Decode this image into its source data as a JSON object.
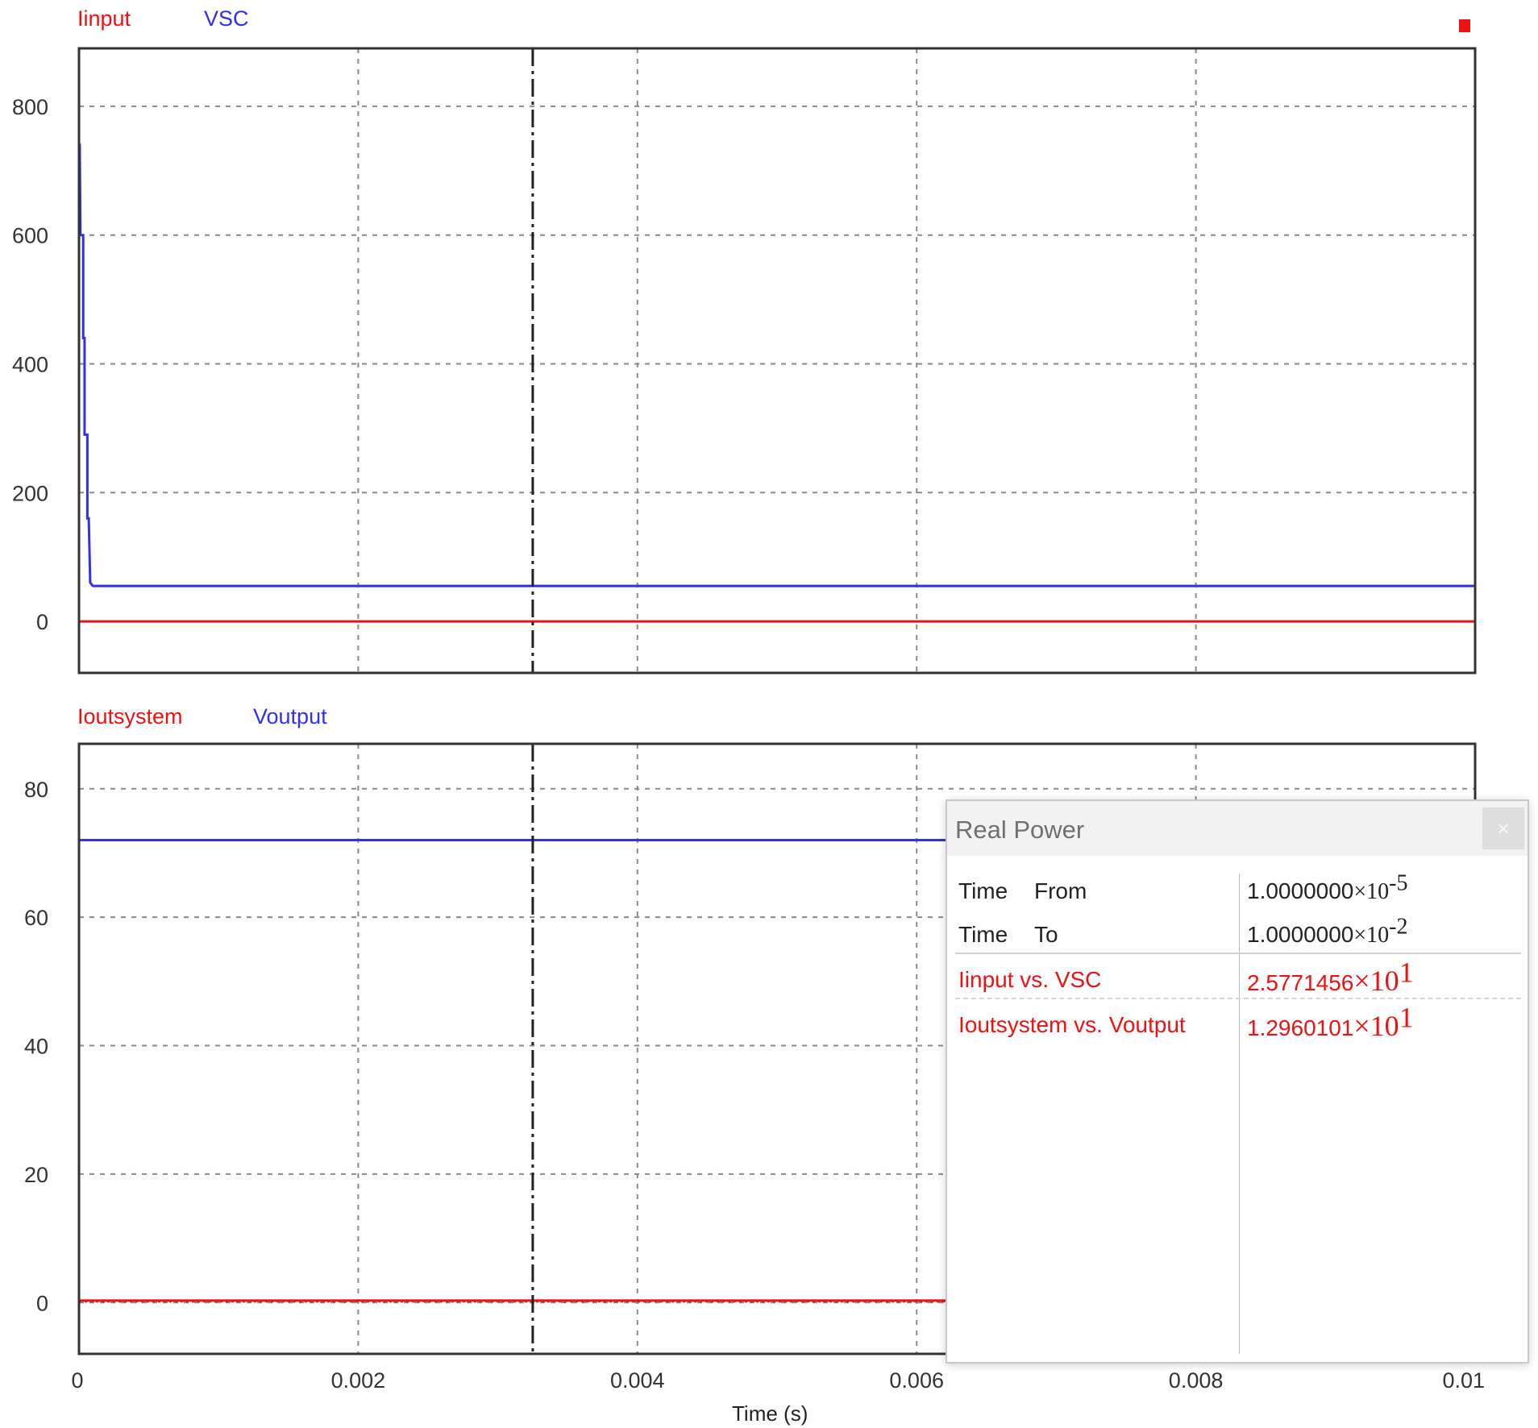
{
  "corner_marker_color": "#ee1111",
  "colors": {
    "red_trace": "#ee1111",
    "blue_trace": "#3030ee",
    "grid": "#8a8a8a",
    "cursor": "#222222"
  },
  "plots": [
    {
      "legend": [
        {
          "label": "Iinput",
          "color": "#ee1111"
        },
        {
          "label": "VSC",
          "color": "#3030ee"
        }
      ],
      "y_ticks": [
        "800",
        "600",
        "400",
        "200",
        "0"
      ]
    },
    {
      "legend": [
        {
          "label": "Ioutsystem",
          "color": "#ee1111"
        },
        {
          "label": "Voutput",
          "color": "#3030ee"
        }
      ],
      "y_ticks": [
        "80",
        "60",
        "40",
        "20",
        "0"
      ]
    }
  ],
  "x_ticks": [
    "0",
    "0.002",
    "0.004",
    "0.006",
    "0.008",
    "0.01"
  ],
  "x_label": "Time (s)",
  "chart_data": [
    {
      "type": "line",
      "xlim": [
        0,
        0.01
      ],
      "ylim": [
        -80,
        890
      ],
      "yticks": [
        0,
        200,
        400,
        600,
        800
      ],
      "grid": true,
      "series": [
        {
          "name": "Iinput",
          "color": "#ee1111",
          "x": [
            0,
            0.01
          ],
          "y": [
            0,
            0
          ]
        },
        {
          "name": "VSC",
          "color": "#3030ee",
          "x": [
            0,
            5e-06,
            1e-05,
            1e-05,
            3e-05,
            3e-05,
            4e-05,
            4e-05,
            6e-05,
            6e-05,
            7e-05,
            8e-05,
            0.0001,
            0.01
          ],
          "y": [
            740,
            740,
            610,
            600,
            600,
            440,
            440,
            290,
            290,
            160,
            160,
            60,
            55,
            55
          ]
        }
      ],
      "cursor_x": 0.00325
    },
    {
      "type": "line",
      "xlim": [
        0,
        0.01
      ],
      "ylim": [
        -8,
        87
      ],
      "yticks": [
        0,
        20,
        40,
        60,
        80
      ],
      "grid": true,
      "series": [
        {
          "name": "Ioutsystem",
          "color": "#ee1111",
          "x": [
            0,
            0.01
          ],
          "y": [
            0.3,
            0.3
          ]
        },
        {
          "name": "Voutput",
          "color": "#3030ee",
          "x": [
            0,
            0.01
          ],
          "y": [
            72,
            72
          ]
        }
      ],
      "cursor_x": 0.00325
    }
  ],
  "popup": {
    "title": "Real Power",
    "close_label": "×",
    "rows": [
      {
        "label1": "Time",
        "label2": "From",
        "mant": "1.0000000",
        "base": "×10",
        "exp": "-5",
        "color": "dark"
      },
      {
        "label1": "Time",
        "label2": "To",
        "mant": "1.0000000",
        "base": "×10",
        "exp": "-2",
        "color": "dark"
      },
      {
        "label": "Iinput vs. VSC",
        "mant": "2.5771456",
        "base": "×10",
        "exp": "1",
        "color": "red"
      },
      {
        "label": "Ioutsystem vs. Voutput",
        "mant": "1.2960101",
        "base": "×10",
        "exp": "1",
        "color": "red"
      }
    ]
  }
}
